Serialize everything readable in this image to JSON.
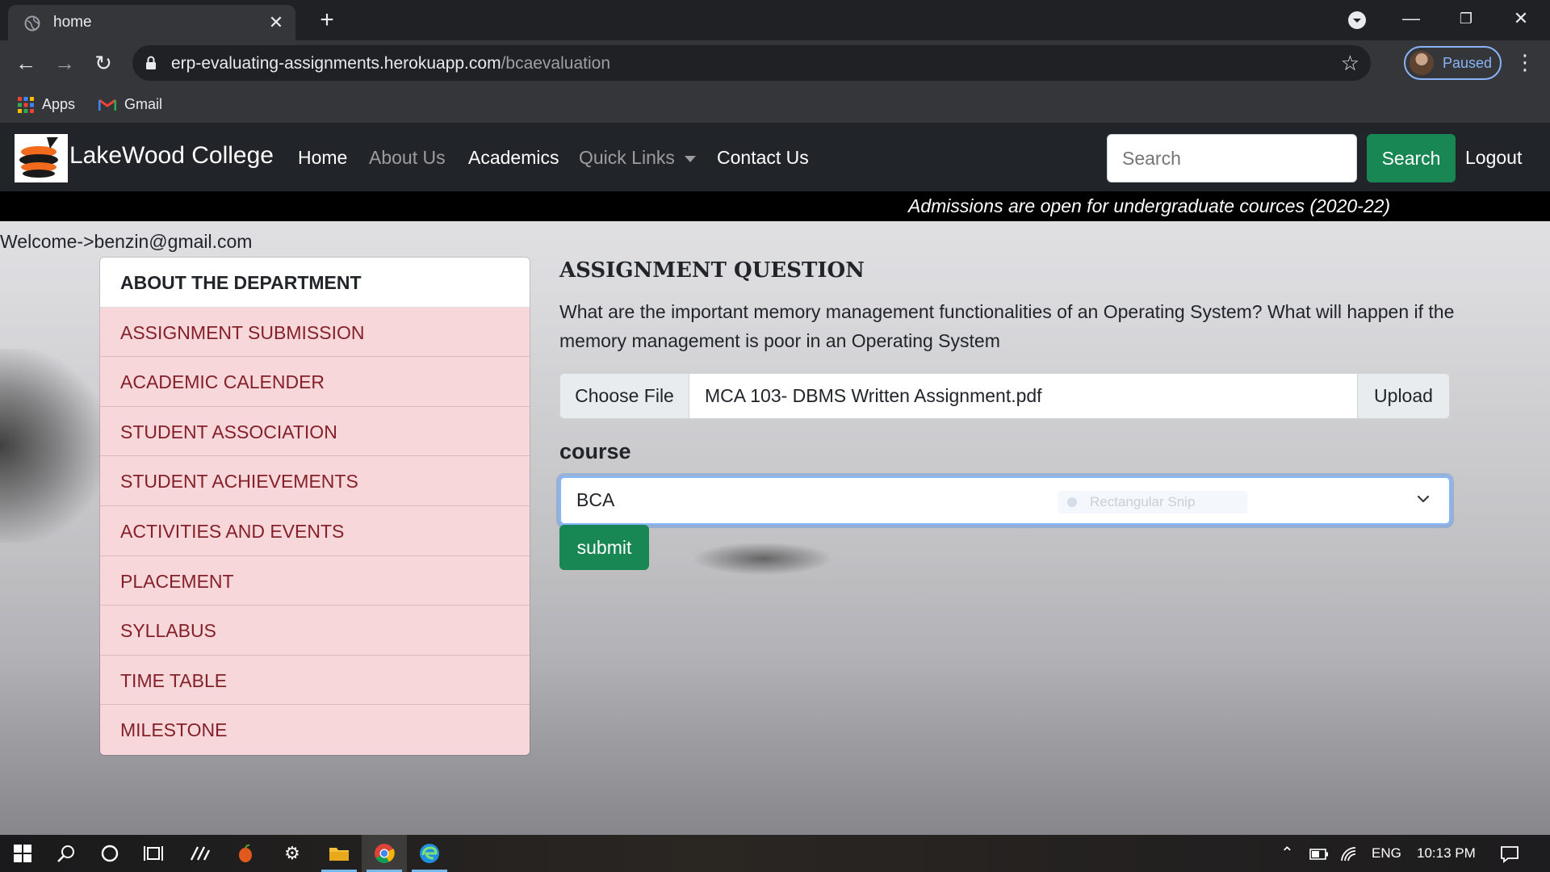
{
  "browser": {
    "tab_title": "home",
    "url_host": "erp-evaluating-assignments.herokuapp.com",
    "url_path": "/bcaevaluation",
    "profile_label": "Paused",
    "bookmarks": [
      {
        "label": "Apps",
        "icon": "apps-grid-icon"
      },
      {
        "label": "Gmail",
        "icon": "gmail-icon"
      }
    ]
  },
  "navbar": {
    "brand": "LakeWood College",
    "links": [
      {
        "label": "Home",
        "state": "active"
      },
      {
        "label": "About Us",
        "state": "muted"
      },
      {
        "label": "Academics",
        "state": "active"
      },
      {
        "label": "Quick Links",
        "state": "muted"
      },
      {
        "label": "Contact Us",
        "state": "active"
      }
    ],
    "search_placeholder": "Search",
    "search_button": "Search",
    "logout": "Logout"
  },
  "announcement": "Admissions are open for undergraduate cources (2020-22)",
  "welcome": "Welcome->benzin@gmail.com",
  "sidebar": {
    "header": "ABOUT THE DEPARTMENT",
    "items": [
      "ASSIGNMENT SUBMISSION",
      "ACADEMIC CALENDER",
      "STUDENT ASSOCIATION",
      "STUDENT ACHIEVEMENTS",
      "ACTIVITIES AND EVENTS",
      "PLACEMENT",
      "SYLLABUS",
      "TIME TABLE",
      "MILESTONE"
    ]
  },
  "assignment": {
    "title": "ASSIGNMENT QUESTION",
    "question": "What are the important memory management functionalities of an Operating System? What will happen if the memory management is poor in an Operating System",
    "choose_file": "Choose File",
    "file_name": "MCA 103- DBMS Written Assignment.pdf",
    "upload": "Upload",
    "course_label": "course",
    "course_value": "BCA",
    "ghost_overlay": "Rectangular Snip",
    "submit": "submit"
  },
  "taskbar": {
    "language": "ENG",
    "time": "10:13 PM"
  },
  "colors": {
    "primary_green": "#198754",
    "list_item_bg": "#f8d7da",
    "list_item_text": "#842029",
    "navbar_bg": "#212529",
    "focus_ring": "#86b7fe"
  }
}
